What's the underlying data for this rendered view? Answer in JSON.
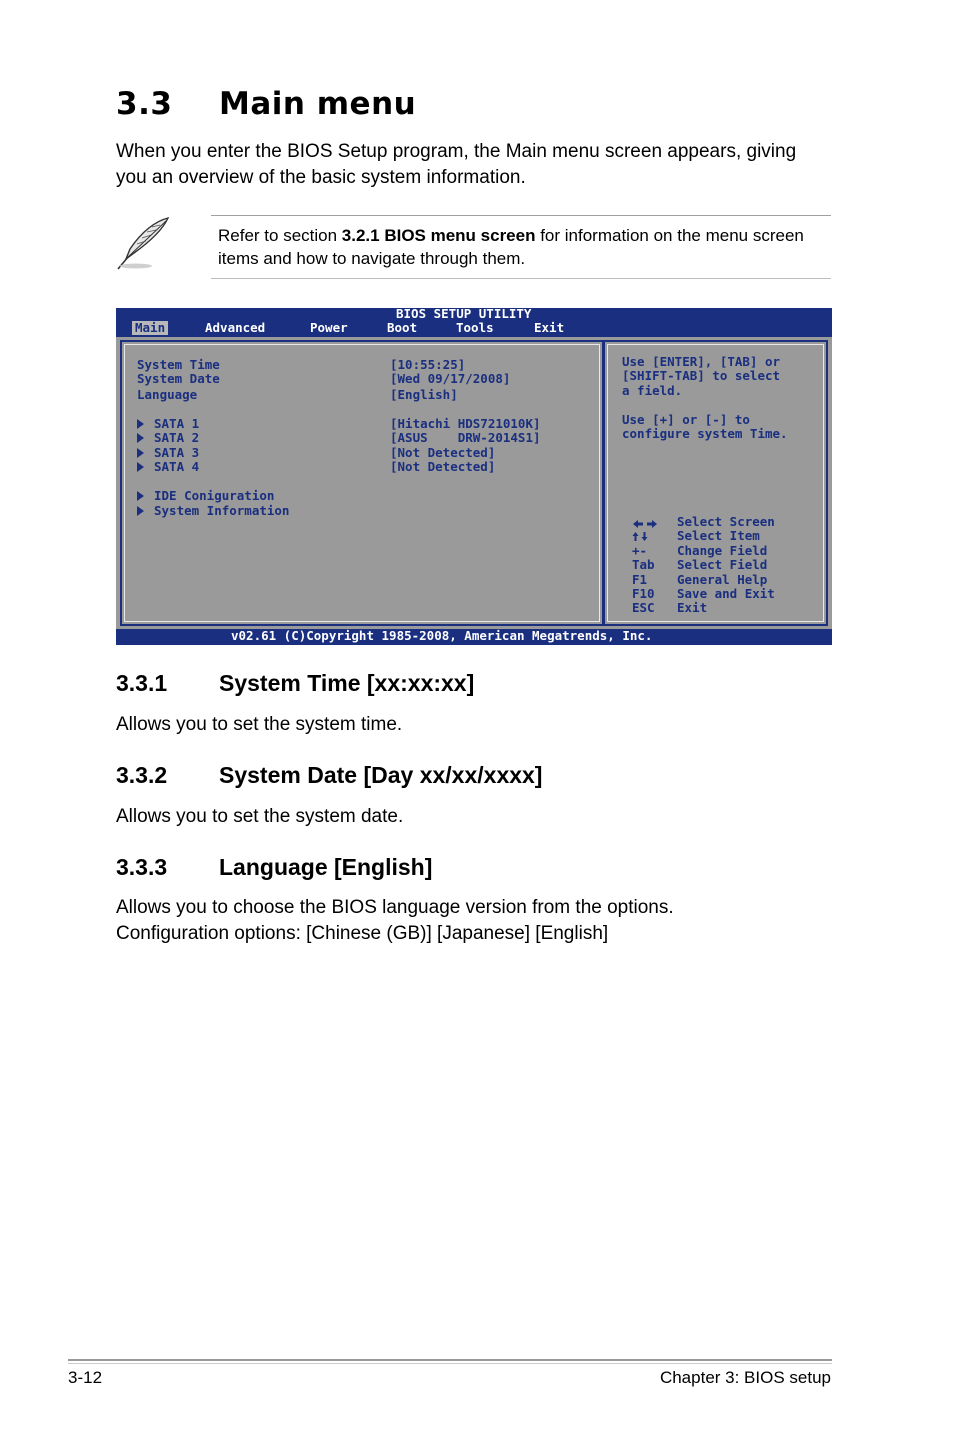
{
  "title": {
    "number": "3.3",
    "text": "Main menu"
  },
  "intro": [
    "When you enter the BIOS Setup program, the Main menu screen appears, giving",
    "you an overview of the basic system information."
  ],
  "note": {
    "icon": "feather-pen-icon",
    "line1_pre": "Refer to section ",
    "line1_bold": "3.2.1 BIOS menu screen",
    "line1_post": " for information on the menu screen",
    "line2": "items and how to navigate through them."
  },
  "bios": {
    "header": "BIOS SETUP UTILITY",
    "menu": [
      "Main",
      "Advanced",
      "Power",
      "Boot",
      "Tools",
      "Exit"
    ],
    "selected_menu": "Main",
    "items": [
      {
        "label": "System Time",
        "value": "[10:55:25]"
      },
      {
        "label": "System Date",
        "value": "[Wed 09/17/2008]"
      },
      {
        "label": "Language",
        "value": "[English]"
      }
    ],
    "sata": [
      {
        "label": "SATA 1",
        "value": "[Hitachi HDS721010K]"
      },
      {
        "label": "SATA 2",
        "value": "[ASUS    DRW-2014S1]"
      },
      {
        "label": "SATA 3",
        "value": "[Not Detected]"
      },
      {
        "label": "SATA 4",
        "value": "[Not Detected]"
      }
    ],
    "submenus": [
      "IDE Coniguration",
      "System Information"
    ],
    "help": [
      "Use [ENTER], [TAB] or",
      "[SHIFT-TAB] to select",
      "a field.",
      "",
      "Use [+] or [-] to",
      "configure system Time."
    ],
    "keys": [
      {
        "key": "",
        "desc": "Select Screen",
        "icon": "left-right-arrows-icon"
      },
      {
        "key": "",
        "desc": "Select Item",
        "icon": "up-down-arrows-icon"
      },
      {
        "key": "+-",
        "desc": "Change Field"
      },
      {
        "key": "Tab",
        "desc": "Select Field"
      },
      {
        "key": "F1",
        "desc": "General Help"
      },
      {
        "key": "F10",
        "desc": "Save and Exit"
      },
      {
        "key": "ESC",
        "desc": "Exit"
      }
    ],
    "footer": "v02.61 (C)Copyright 1985-2008, American Megatrends, Inc.",
    "colors": {
      "blue": "#1a2f80",
      "panel": "#9a9a9a"
    }
  },
  "sections": [
    {
      "number": "3.3.1",
      "title": "System Time [xx:xx:xx]",
      "body": [
        "Allows you to set the system time."
      ]
    },
    {
      "number": "3.3.2",
      "title": "System Date [Day xx/xx/xxxx]",
      "body": [
        "Allows you to set the system date."
      ]
    },
    {
      "number": "3.3.3",
      "title": "Language [English]",
      "body": [
        "Allows you to choose the BIOS language version from the options.",
        "Configuration options: [Chinese (GB)] [Japanese] [English]"
      ]
    }
  ],
  "footer": {
    "page": "3-12",
    "chapter": "Chapter 3: BIOS setup"
  }
}
